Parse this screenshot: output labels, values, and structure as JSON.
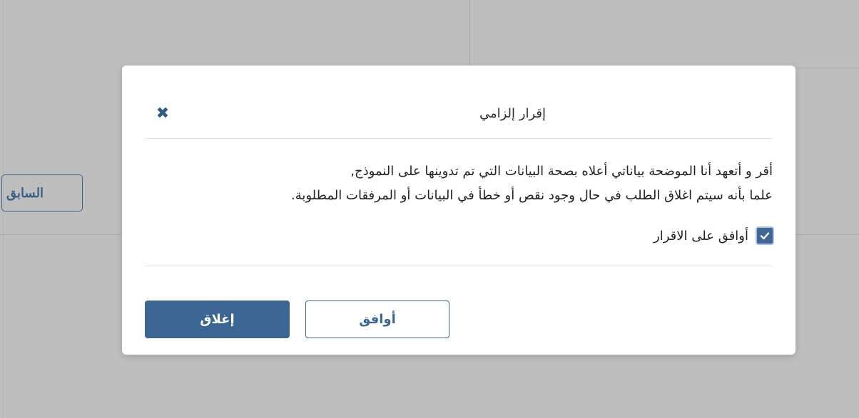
{
  "background": {
    "prev_button_label": "السابق"
  },
  "modal": {
    "title": "إقرار إلزامي",
    "close_icon": "close-icon",
    "body_line_1": "أقر و أتعهد أنا الموضحة بياناتي أعلاه بصحة البيانات التي تم تدوينها على النموذج,",
    "body_line_2": "علما بأنه سيتم اغلاق الطلب في حال وجود نقص أو خطأ في البيانات أو المرفقات المطلوبة.",
    "agree_checkbox_label": "أوافق على الاقرار",
    "agree_checked": true,
    "agree_button_label": "أوافق",
    "close_button_label": "إغلاق"
  },
  "colors": {
    "primary": "#3b6593",
    "overlay": "#bebebe",
    "checkbox_border": "#a9c3e6"
  }
}
